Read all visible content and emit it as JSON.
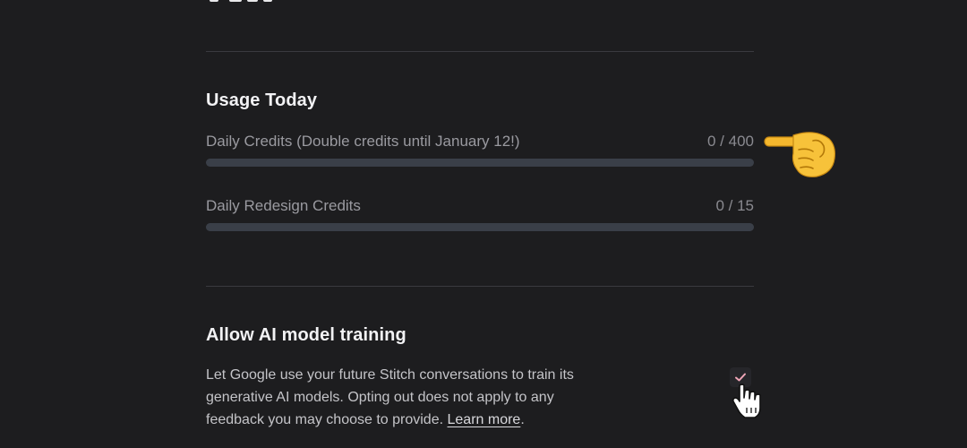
{
  "usage": {
    "title": "Usage Today",
    "rows": [
      {
        "label": "Daily Credits (Double credits until January 12!)",
        "count_text": "0 / 400",
        "used": 0,
        "total": 400
      },
      {
        "label": "Daily Redesign Credits",
        "count_text": "0 / 15",
        "used": 0,
        "total": 15
      }
    ]
  },
  "training": {
    "title": "Allow AI model training",
    "description_line1": "Let Google use your future Stitch conversations to train its",
    "description_line2": "generative AI models. Opting out does not apply to any",
    "description_line3": "feedback you may choose to provide.",
    "learn_more_label": "Learn more",
    "trailing_period": ".",
    "checked": true
  },
  "colors": {
    "background": "#1d1d1f",
    "track": "#3a3f48",
    "check_mark": "#f0a6b8",
    "pointer_emoji": "#f5b82e"
  },
  "icons": {
    "pointer": "backhand-index-pointing-right-icon",
    "cursor": "hand-cursor-icon",
    "check": "check-icon"
  }
}
